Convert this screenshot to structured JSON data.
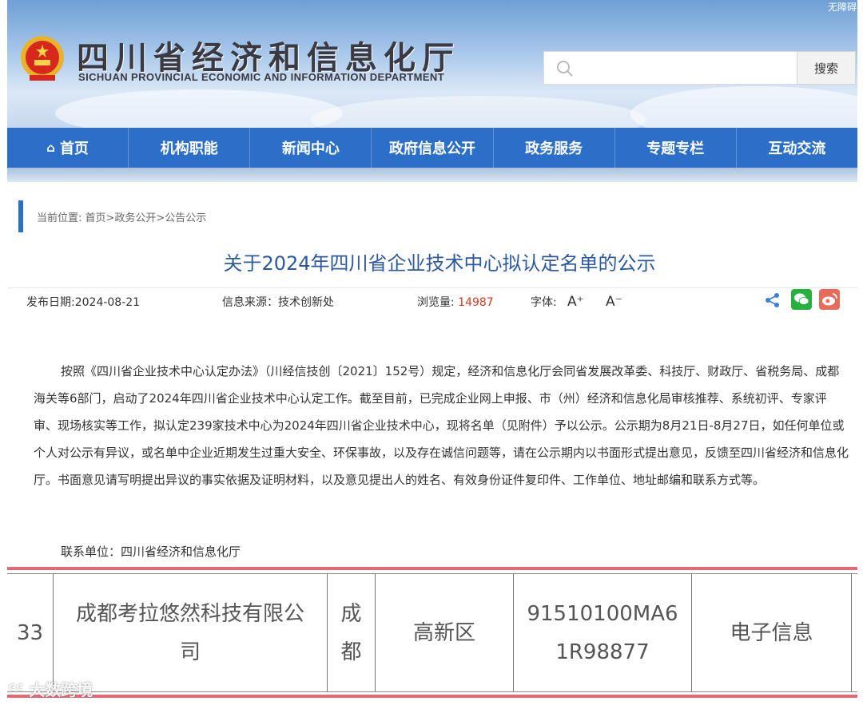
{
  "header": {
    "accessibility": "无障碍",
    "title_cn": "四川省经济和信息化厅",
    "title_en": "SICHUAN PROVINCIAL ECONOMIC AND INFORMATION DEPARTMENT",
    "search_placeholder": "",
    "search_button": "搜索"
  },
  "nav": {
    "items": [
      "首页",
      "机构职能",
      "新闻中心",
      "政府信息公开",
      "政务服务",
      "专题专栏",
      "互动交流"
    ]
  },
  "breadcrumb": "当前位置: 首页>政务公开>公告公示",
  "article": {
    "title": "关于2024年四川省企业技术中心拟认定名单的公示",
    "publish_date": "发布日期:2024-08-21",
    "source": "信息来源：技术创新处",
    "views_label": "浏览量: ",
    "views_value": "14987",
    "font_label": "字体:",
    "font_increase": "A⁺",
    "font_decrease": "A⁻",
    "body": "按照《四川省企业技术中心认定办法》（川经信技创〔2021〕152号）规定，经济和信息化厅会同省发展改革委、科技厅、财政厅、省税务局、成都海关等6部门，启动了2024年四川省企业技术中心认定工作。截至目前，已完成企业网上申报、市（州）经济和信息化局审核推荐、系统初评、专家评审、现场核实等工作，拟认定239家技术中心为2024年四川省企业技术中心，现将名单（见附件）予以公示。公示期为8月21日-8月27日，如任何单位或个人对公示有异议，或名单中企业近期发生过重大安全、环保事故，以及存在诚信问题等，请在公示期内以书面形式提出意见，反馈至四川省经济和信息化厅。书面意见请写明提出异议的事实依据及证明材料，以及意见提出人的姓名、有效身份证件复印件、工作单位、地址邮编和联系方式等。",
    "contact": "联系单位：四川省经济和信息化厅"
  },
  "table_row": {
    "index": "33",
    "company": "成都考拉悠然科技有限公司",
    "city": "成都",
    "district": "高新区",
    "credit_code": "91510100MA61R98877",
    "industry": "电子信息"
  },
  "watermark": "大数跨境",
  "colors": {
    "nav_blue": "#2c6fc8",
    "title_blue": "#2c5aa0",
    "views_red": "#d9391f",
    "table_rule_pink": "#e06a78"
  }
}
